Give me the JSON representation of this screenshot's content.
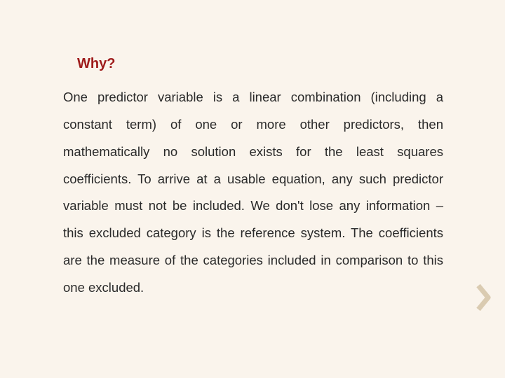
{
  "title": "Why?",
  "body": "One predictor variable is a linear combination (including a constant term) of one or more other predictors, then mathematically no solution exists for the least squares coefficients. To arrive at a usable equation, any such predictor variable must not be included. We don't lose any information – this excluded category is the reference system. The coefficients are the measure of the categories included in comparison to this one excluded."
}
